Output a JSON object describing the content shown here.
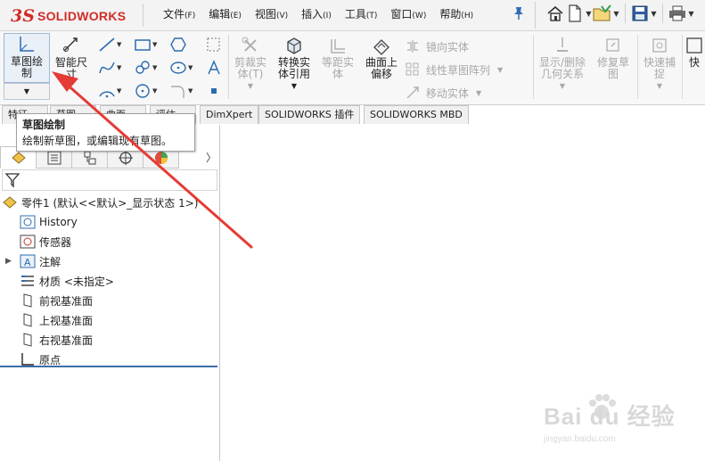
{
  "app": {
    "logo_text": "SOLIDWORKS",
    "logo_mark": "3S",
    "brand_color": "#d22c26"
  },
  "menu": [
    {
      "label": "文件",
      "accel": "(F)"
    },
    {
      "label": "编辑",
      "accel": "(E)"
    },
    {
      "label": "视图",
      "accel": "(V)"
    },
    {
      "label": "插入",
      "accel": "(I)"
    },
    {
      "label": "工具",
      "accel": "(T)"
    },
    {
      "label": "窗口",
      "accel": "(W)"
    },
    {
      "label": "帮助",
      "accel": "(H)"
    }
  ],
  "quick_access": [
    "home-icon",
    "new-document-icon",
    "open-folder-icon",
    "save-icon",
    "print-icon"
  ],
  "ribbon": {
    "sketch": {
      "line1": "草图绘",
      "line2": "制"
    },
    "smart_dim": {
      "line1": "智能尺",
      "line2": "寸"
    },
    "trim": {
      "line1": "剪裁实",
      "line2": "体(T)"
    },
    "convert": {
      "line1": "转换实",
      "line2": "体引用"
    },
    "offset": {
      "line1": "等距实",
      "line2": "体"
    },
    "surface_offset": {
      "line1": "曲面上",
      "line2": "偏移"
    },
    "mirror": "镜向实体",
    "linear_pattern": "线性草图阵列",
    "move": "移动实体",
    "show_relations": {
      "line1": "显示/删除",
      "line2": "几何关系"
    },
    "repair": {
      "line1": "修复草",
      "line2": "图"
    },
    "quick_snap": {
      "line1": "快速捕",
      "line2": "捉"
    },
    "rapid": {
      "line1": "快"
    }
  },
  "tabs": [
    "特征",
    "草图",
    "曲面",
    "评估",
    "DimXpert",
    "SOLIDWORKS 插件",
    "SOLIDWORKS MBD"
  ],
  "tooltip": {
    "title": "草图绘制",
    "description": "绘制新草图，或编辑现有草图。"
  },
  "tree": {
    "root": "零件1  (默认<<默认>_显示状态 1>)",
    "items": [
      {
        "label": "History",
        "icon": "history-icon"
      },
      {
        "label": "传感器",
        "icon": "sensor-icon"
      },
      {
        "label": "注解",
        "icon": "annotation-icon",
        "expandable": true
      },
      {
        "label": "材质 <未指定>",
        "icon": "material-icon"
      },
      {
        "label": "前视基准面",
        "icon": "plane-icon"
      },
      {
        "label": "上视基准面",
        "icon": "plane-icon"
      },
      {
        "label": "右视基准面",
        "icon": "plane-icon"
      },
      {
        "label": "原点",
        "icon": "origin-icon"
      }
    ]
  },
  "watermark": {
    "brand": "Bai du 经验",
    "url": "jingyan.baidu.com"
  }
}
